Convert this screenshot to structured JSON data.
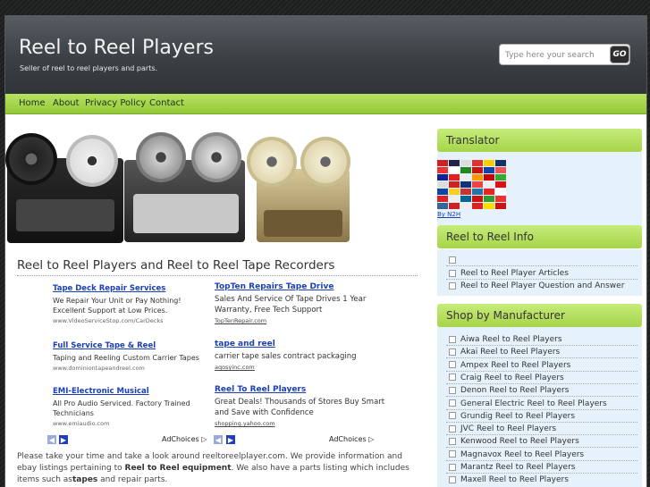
{
  "header": {
    "title": "Reel to Reel Players",
    "tagline": "Seller of reel to reel players and parts.",
    "search_placeholder": "Type here your search",
    "search_button": "GO"
  },
  "nav": {
    "items": [
      "Home",
      "About",
      "Privacy Policy",
      "Contact"
    ]
  },
  "main": {
    "title": "Reel to Reel Players and Reel to Reel Tape Recorders",
    "ads_left": [
      {
        "title": "Tape Deck Repair Services",
        "desc": "We Repair Your Unit or Pay Nothing! Excellent Support at Low Prices.",
        "url": "www.VideoServiceStop.com/CarDecks"
      },
      {
        "title": "Full Service Tape & Reel",
        "desc": "Taping and Reeling Custom Carrier Tapes",
        "url": "www.dominiontapeandreel.com"
      },
      {
        "title": "EMI-Electronic Musical",
        "desc": "All Pro Audio Serviced. Factory Trained Technicians",
        "url": "www.emiaudio.com"
      }
    ],
    "ads_right": [
      {
        "title": "TopTen Repairs Tape Drive",
        "desc": "Sales And Service Of Tape Drives 1 Year Warranty, Free Tech Support",
        "url": "TopTenRepair.com"
      },
      {
        "title": "tape and reel",
        "desc": "carrier tape sales contract packaging",
        "url": "aqosyinc.com"
      },
      {
        "title": "Reel To Reel Players",
        "desc": "Great Deals! Thousands of Stores Buy Smart and Save with Confidence",
        "url": "shopping.yahoo.com"
      }
    ],
    "adchoices": "AdChoices",
    "intro": {
      "p1": "Please take your time and take a look around reeltoreelplayer.com. We provide information and ebay listings pertaining to ",
      "b1": "Reel to Reel equipment",
      "p2": ". We also have a parts listing which includes items such as",
      "b2": "tapes",
      "p3": " and repair parts."
    }
  },
  "sidebar": {
    "translator": {
      "heading": "Translator",
      "by": "By N2H"
    },
    "info": {
      "heading": "Reel to Reel Info",
      "links": [
        "Reel to Reel Player Articles",
        "Reel to Reel Player Question and Answer"
      ]
    },
    "shop": {
      "heading": "Shop by Manufacturer",
      "links": [
        "Aiwa Reel to Reel Players",
        "Akai Reel to Reel Players",
        "Ampex Reel to Reel Players",
        "Craig Reel to Reel Players",
        "Denon Reel to Reel Players",
        "General Electric Reel to Reel Players",
        "Grundig Reel to Reel Players",
        "JVC Reel to Reel Players",
        "Kenwood Reel to Reel Players",
        "Magnavox Reel to Reel Players",
        "Marantz Reel to Reel Players",
        "Maxell Reel to Reel Players"
      ]
    }
  },
  "colors": {
    "nav_green": "#a6d44a",
    "header_dark": "#3b4045",
    "ad_link_blue": "#1b3fb8"
  }
}
